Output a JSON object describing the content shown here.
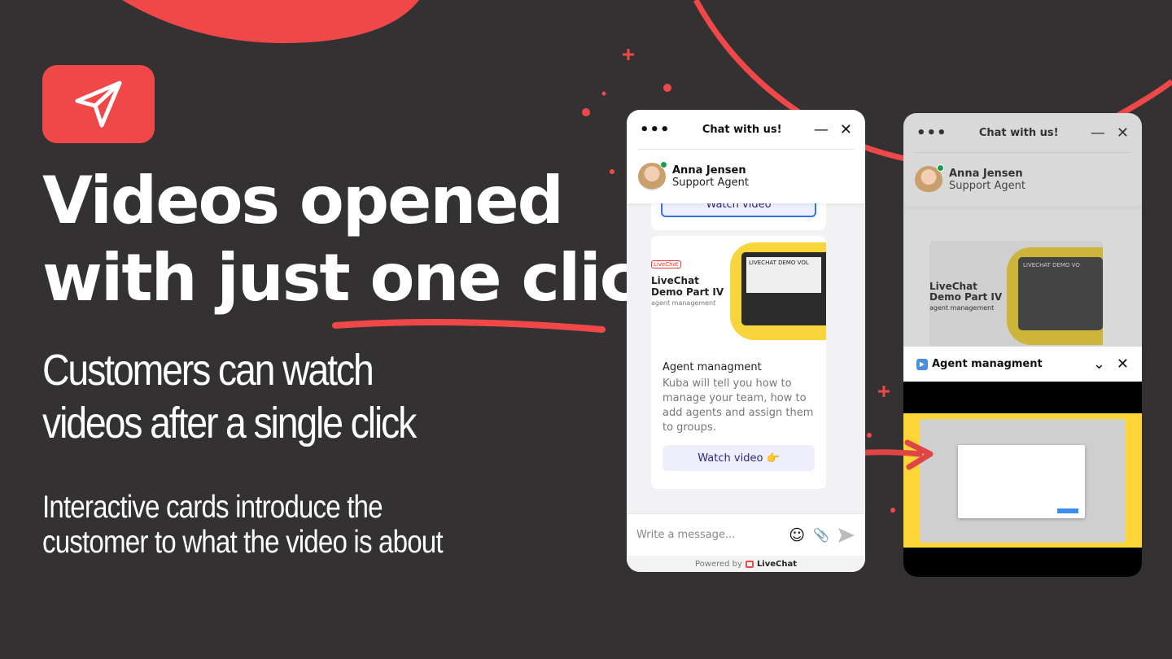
{
  "colors": {
    "background": "#333132",
    "accent": "#f04848",
    "online": "#1a9c50",
    "video_yellow": "#fdd535",
    "button_text": "#2b2a7a"
  },
  "logo": {
    "icon": "paper-plane-icon"
  },
  "headline": {
    "line1": "Videos opened",
    "line2_prefix": "with just ",
    "line2_highlight": "one click"
  },
  "subtitle": {
    "line1": "Customers can watch",
    "line2": "videos after a single click"
  },
  "description": {
    "line1": "Interactive cards introduce the",
    "line2": "customer to what the video is about"
  },
  "widget": {
    "title": "Chat with us!",
    "agent": {
      "name": "Anna Jensen",
      "role": "Support Agent"
    },
    "prev_card_button": "Watch video",
    "card": {
      "image": {
        "brand": "LiveChat",
        "title_line1": "LiveChat",
        "title_line2": "Demo Part IV",
        "caption": "agent management",
        "cassette_label": "LIVECHAT DEMO VOL"
      },
      "title": "Agent managment",
      "text": "Kuba will tell you how to manage your team, how to add agents and assign them to groups.",
      "button": "Watch video 👉"
    },
    "input_placeholder": "Write a message...",
    "powered_by": "Powered by",
    "brand": "LiveChat"
  },
  "widget2": {
    "title": "Chat with us!",
    "agent": {
      "name": "Anna Jensen",
      "role": "Support Agent"
    },
    "card_image": {
      "title_line1": "LiveChat",
      "title_line2": "Demo Part IV",
      "caption": "agent management",
      "cassette_label": "LIVECHAT DEMO VO"
    },
    "video_title": "Agent managment",
    "video_icon": "play-button-icon"
  }
}
